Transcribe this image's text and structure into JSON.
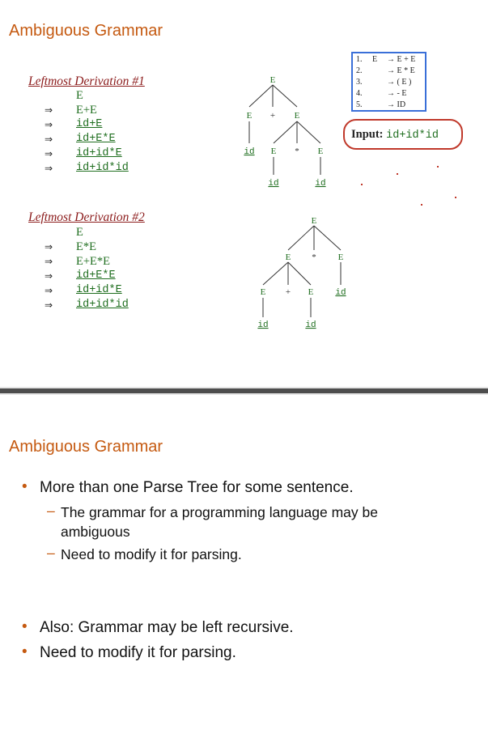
{
  "slide1": {
    "title": "Ambiguous Grammar",
    "derivation1": {
      "heading": "Leftmost Derivation #1",
      "start": "E",
      "steps": [
        "E+E",
        "id+E",
        "id+E*E",
        "id+id*E",
        "id+id*id"
      ]
    },
    "derivation2": {
      "heading": "Leftmost Derivation #2",
      "start": "E",
      "steps": [
        "E*E",
        "E+E*E",
        "id+E*E",
        "id+id*E",
        "id+id*id"
      ]
    },
    "arrow": "⇒",
    "grammar": {
      "lhs": "E",
      "rules": [
        {
          "num": "1.",
          "rhs": "→ E + E"
        },
        {
          "num": "2.",
          "rhs": "→ E * E"
        },
        {
          "num": "3.",
          "rhs": "→ ( E )"
        },
        {
          "num": "4.",
          "rhs": "→ - E"
        },
        {
          "num": "5.",
          "rhs": "→ ID"
        }
      ]
    },
    "input": {
      "label": "Input:",
      "value": "id+id*id"
    },
    "tree1": {
      "root": "E",
      "mid": [
        "E",
        "+",
        "E"
      ],
      "low": [
        "id",
        "E",
        "*",
        "E"
      ],
      "leaves": [
        "id",
        "id"
      ]
    },
    "tree2": {
      "root": "E",
      "mid": [
        "E",
        "*",
        "E"
      ],
      "low": [
        "E",
        "+",
        "E",
        "id"
      ],
      "leaves": [
        "id",
        "id"
      ]
    }
  },
  "slide2": {
    "title": "Ambiguous Grammar",
    "bullets": [
      {
        "text": "More than one Parse Tree for some sentence.",
        "sub": [
          "The grammar for a programming language may be ambiguous",
          "Need to modify it for parsing."
        ]
      },
      {
        "text": "Also: Grammar may be left recursive.",
        "sub": []
      },
      {
        "text": "Need to modify it for parsing.",
        "sub": []
      }
    ]
  }
}
